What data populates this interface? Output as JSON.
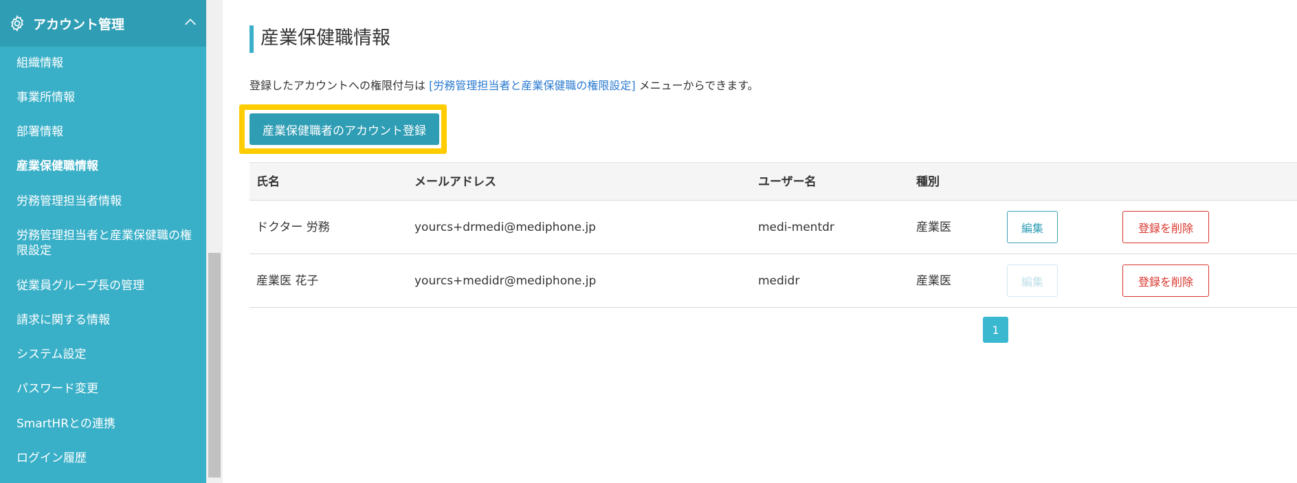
{
  "sidebar": {
    "header": {
      "title": "アカウント管理",
      "icon": "gear-icon",
      "toggle_icon": "chevron-up-icon"
    },
    "items": [
      {
        "label": "組織情報",
        "active": false
      },
      {
        "label": "事業所情報",
        "active": false
      },
      {
        "label": "部署情報",
        "active": false
      },
      {
        "label": "産業保健職情報",
        "active": true
      },
      {
        "label": "労務管理担当者情報",
        "active": false
      },
      {
        "label": "労務管理担当者と産業保健職の権限設定",
        "active": false
      },
      {
        "label": "従業員グループ長の管理",
        "active": false
      },
      {
        "label": "請求に関する情報",
        "active": false
      },
      {
        "label": "システム設定",
        "active": false
      },
      {
        "label": "パスワード変更",
        "active": false
      },
      {
        "label": "SmartHRとの連携",
        "active": false
      },
      {
        "label": "ログイン履歴",
        "active": false
      }
    ]
  },
  "main": {
    "title": "産業保健職情報",
    "notice": {
      "before": "登録したアカウントへの権限付与は ",
      "link": "[労務管理担当者と産業保健職の権限設定]",
      "after": " メニューからできます。"
    },
    "register_button": "産業保健職者のアカウント登録",
    "table": {
      "headers": {
        "name": "氏名",
        "email": "メールアドレス",
        "username": "ユーザー名",
        "type": "種別"
      },
      "rows": [
        {
          "name": "ドクター 労務",
          "email": "yourcs+drmedi@mediphone.jp",
          "username": "medi-mentdr",
          "type": "産業医",
          "edit": "編集",
          "edit_disabled": false,
          "delete": "登録を削除"
        },
        {
          "name": "産業医 花子",
          "email": "yourcs+medidr@mediphone.jp",
          "username": "medidr",
          "type": "産業医",
          "edit": "編集",
          "edit_disabled": true,
          "delete": "登録を削除"
        }
      ]
    },
    "pagination": {
      "current": "1"
    }
  },
  "colors": {
    "sidebar_bg": "#3ab0c8",
    "sidebar_header_bg": "#2f9db4",
    "accent": "#2f9db4",
    "link": "#2a7ad0",
    "danger": "#d9342b",
    "highlight": "#ffcc00"
  }
}
